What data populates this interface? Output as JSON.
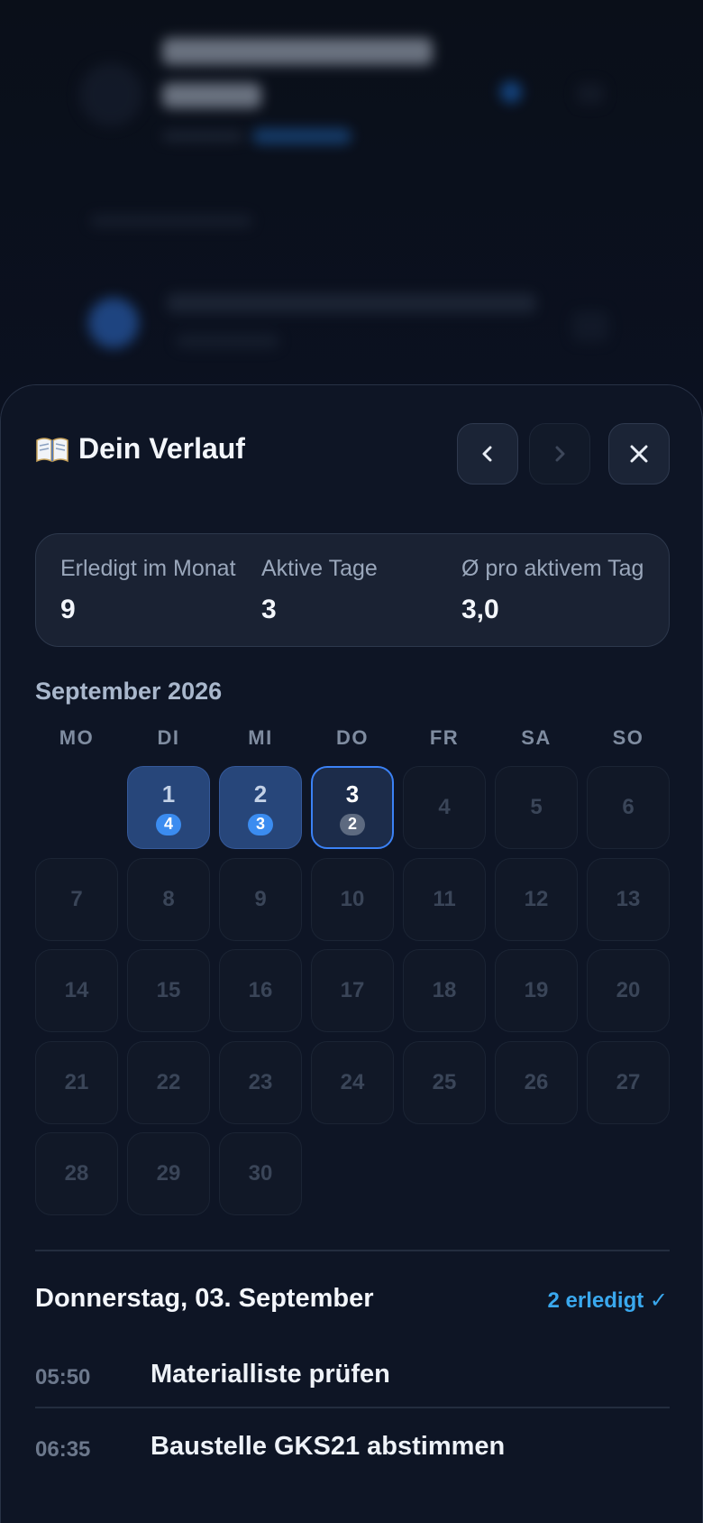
{
  "sheet": {
    "title": "Dein Verlauf",
    "icons": {
      "title": "open-book-icon",
      "prev": "chevron-left-icon",
      "next": "chevron-right-icon",
      "close": "close-icon"
    }
  },
  "stats": [
    {
      "label": "Erledigt im Monat",
      "value": "9"
    },
    {
      "label": "Aktive Tage",
      "value": "3"
    },
    {
      "label": "Ø pro aktivem Tag",
      "value": "3,0"
    }
  ],
  "calendar": {
    "month": "September 2026",
    "weekdays": [
      "MO",
      "DI",
      "MI",
      "DO",
      "FR",
      "SA",
      "SO"
    ],
    "days": [
      {
        "day": "1",
        "count": "4",
        "state": "active"
      },
      {
        "day": "2",
        "count": "3",
        "state": "active"
      },
      {
        "day": "3",
        "count": "2",
        "state": "selected"
      },
      {
        "day": "4"
      },
      {
        "day": "5"
      },
      {
        "day": "6"
      },
      {
        "day": "7"
      },
      {
        "day": "8"
      },
      {
        "day": "9"
      },
      {
        "day": "10"
      },
      {
        "day": "11"
      },
      {
        "day": "12"
      },
      {
        "day": "13"
      },
      {
        "day": "14"
      },
      {
        "day": "15"
      },
      {
        "day": "16"
      },
      {
        "day": "17"
      },
      {
        "day": "18"
      },
      {
        "day": "19"
      },
      {
        "day": "20"
      },
      {
        "day": "21"
      },
      {
        "day": "22"
      },
      {
        "day": "23"
      },
      {
        "day": "24"
      },
      {
        "day": "25"
      },
      {
        "day": "26"
      },
      {
        "day": "27"
      },
      {
        "day": "28"
      },
      {
        "day": "29"
      },
      {
        "day": "30"
      }
    ]
  },
  "detail": {
    "title": "Donnerstag, 03. September",
    "count": "2 erledigt ✓",
    "tasks": [
      {
        "time": "05:50",
        "name": "Materialliste prüfen"
      },
      {
        "time": "06:35",
        "name": "Baustelle GKS21 abstimmen"
      }
    ]
  },
  "colors": {
    "accent": "#3b82f6",
    "badge": "#3b8cf0",
    "done": "#3aa8ee",
    "background": "#0e1525"
  }
}
